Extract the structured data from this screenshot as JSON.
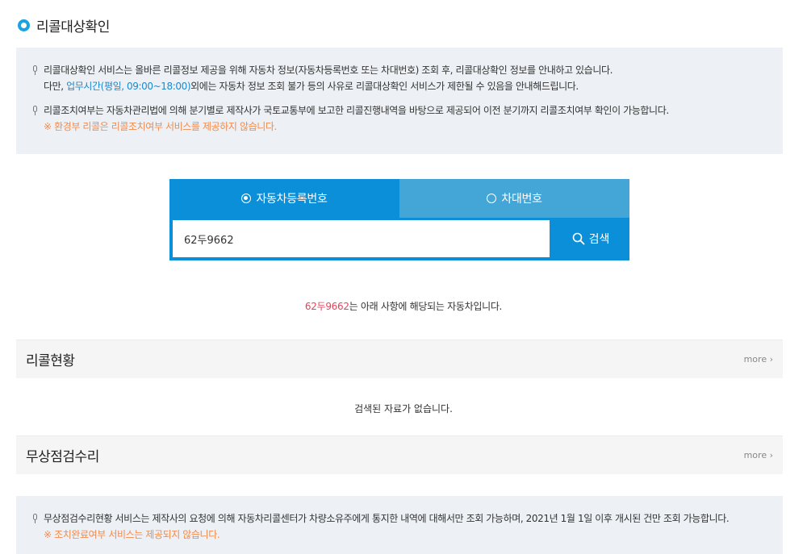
{
  "page": {
    "title": "리콜대상확인"
  },
  "notice_top": {
    "line1": "리콜대상확인 서비스는 올바른 리콜정보 제공을 위해 자동차 정보(자동차등록번호 또는 차대번호) 조회 후, 리콜대상확인 정보를 안내하고 있습니다.",
    "line2_prefix": "다만, ",
    "line2_highlight": "업무시간(평일, 09:00~18:00)",
    "line2_suffix": "외에는 자동차 정보 조회 불가 등의 사유로 리콜대상확인 서비스가 제한될 수 있음을 안내해드립니다.",
    "line3": "리콜조치여부는 자동차관리법에 의해 분기별로 제작사가 국토교통부에 보고한 리콜진행내역을 바탕으로 제공되어 이전 분기까지 리콜조치여부 확인이 가능합니다.",
    "line4": "※ 환경부 리콜은 리콜조치여부 서비스를 제공하지 않습니다."
  },
  "search": {
    "tab_registration": "자동차등록번호",
    "tab_vin": "차대번호",
    "input_value": "62두9662",
    "button_label": "검색"
  },
  "result": {
    "plate": "62두9662",
    "message": "는 아래 사항에 해당되는 자동차입니다."
  },
  "recall_section": {
    "title": "리콜현황",
    "more": "more",
    "empty": "검색된 자료가 없습니다."
  },
  "free_section": {
    "title": "무상점검수리",
    "more": "more"
  },
  "notice_bottom": {
    "line1": "무상점검수리현황 서비스는 제작사의 요청에 의해 자동차리콜센터가 차량소유주에게 통지한 내역에 대해서만 조회 가능하며, 2021년 1월 1일 이후 개시된 건만 조회 가능합니다.",
    "line2": "※ 조치완료여부 서비스는 제공되지 않습니다."
  },
  "colors": {
    "accent": "#0a8fd8",
    "tab_inactive": "#43a6d6",
    "highlight_blue": "#1a8ad0",
    "warning_orange": "#f28a4b",
    "plate_pink": "#e2445c",
    "notice_bg": "#edf1f5"
  },
  "icons": {
    "title_marker": "ring-bullet-icon",
    "notice_bullet": "microphone-icon",
    "search": "search-icon",
    "more": "chevron-right-icon"
  }
}
